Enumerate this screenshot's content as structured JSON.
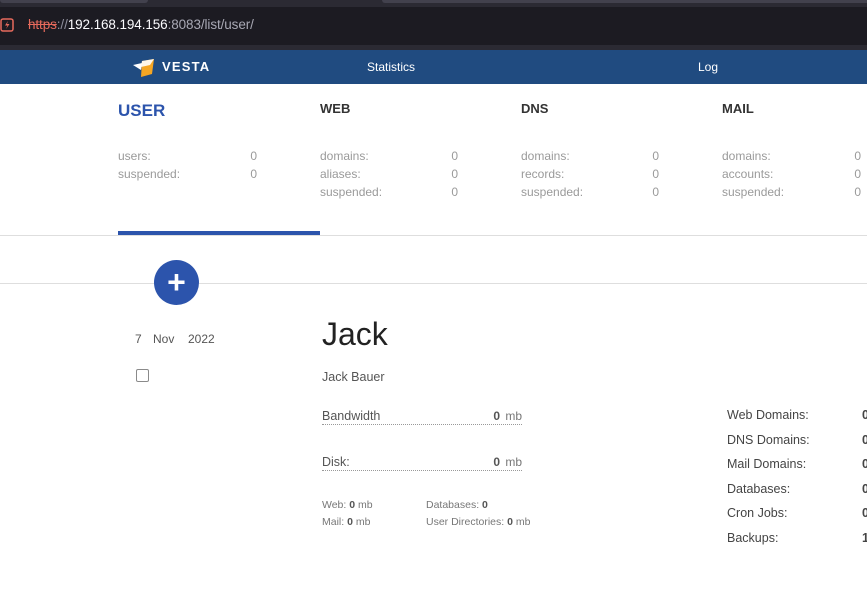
{
  "browser": {
    "url_scheme": "https",
    "url_sep": "://",
    "url_host": "192.168.194.156",
    "url_rest": ":8083/list/user/"
  },
  "nav": {
    "logo": "VESTA",
    "items": [
      {
        "label": "Statistics"
      },
      {
        "label": "Log"
      }
    ]
  },
  "overview": {
    "user": {
      "title": "USER",
      "rows": [
        {
          "label": "users:",
          "value": "0"
        },
        {
          "label": "suspended:",
          "value": "0"
        }
      ]
    },
    "web": {
      "title": "WEB",
      "rows": [
        {
          "label": "domains:",
          "value": "0"
        },
        {
          "label": "aliases:",
          "value": "0"
        },
        {
          "label": "suspended:",
          "value": "0"
        }
      ]
    },
    "dns": {
      "title": "DNS",
      "rows": [
        {
          "label": "domains:",
          "value": "0"
        },
        {
          "label": "records:",
          "value": "0"
        },
        {
          "label": "suspended:",
          "value": "0"
        }
      ]
    },
    "mail": {
      "title": "MAIL",
      "rows": [
        {
          "label": "domains:",
          "value": "0"
        },
        {
          "label": "accounts:",
          "value": "0"
        },
        {
          "label": "suspended:",
          "value": "0"
        }
      ]
    }
  },
  "add_button": {
    "symbol": "+"
  },
  "user_row": {
    "date": {
      "day": "7",
      "month": "Nov",
      "year": "2022"
    },
    "username": "Jack",
    "full_name": "Jack Bauer",
    "bandwidth": {
      "label": "Bandwidth",
      "value": "0",
      "unit": "mb"
    },
    "disk": {
      "label": "Disk:",
      "value": "0",
      "unit": "mb"
    },
    "web": {
      "label": "Web:",
      "value": "0",
      "unit": "mb"
    },
    "mail": {
      "label": "Mail:",
      "value": "0",
      "unit": "mb"
    },
    "databases": {
      "label": "Databases:",
      "value": "0"
    },
    "user_dirs": {
      "label": "User Directories:",
      "value": "0",
      "unit": "mb"
    },
    "stats": [
      {
        "label": "Web Domains:",
        "value": "0"
      },
      {
        "label": "DNS Domains:",
        "value": "0"
      },
      {
        "label": "Mail Domains:",
        "value": "0"
      },
      {
        "label": "Databases:",
        "value": "0"
      },
      {
        "label": "Cron Jobs:",
        "value": "0"
      },
      {
        "label": "Backups:",
        "value": "1"
      }
    ]
  },
  "colors": {
    "nav_bg": "#204b80",
    "accent": "#2c54ac",
    "browser_bg": "#2b2a33"
  }
}
